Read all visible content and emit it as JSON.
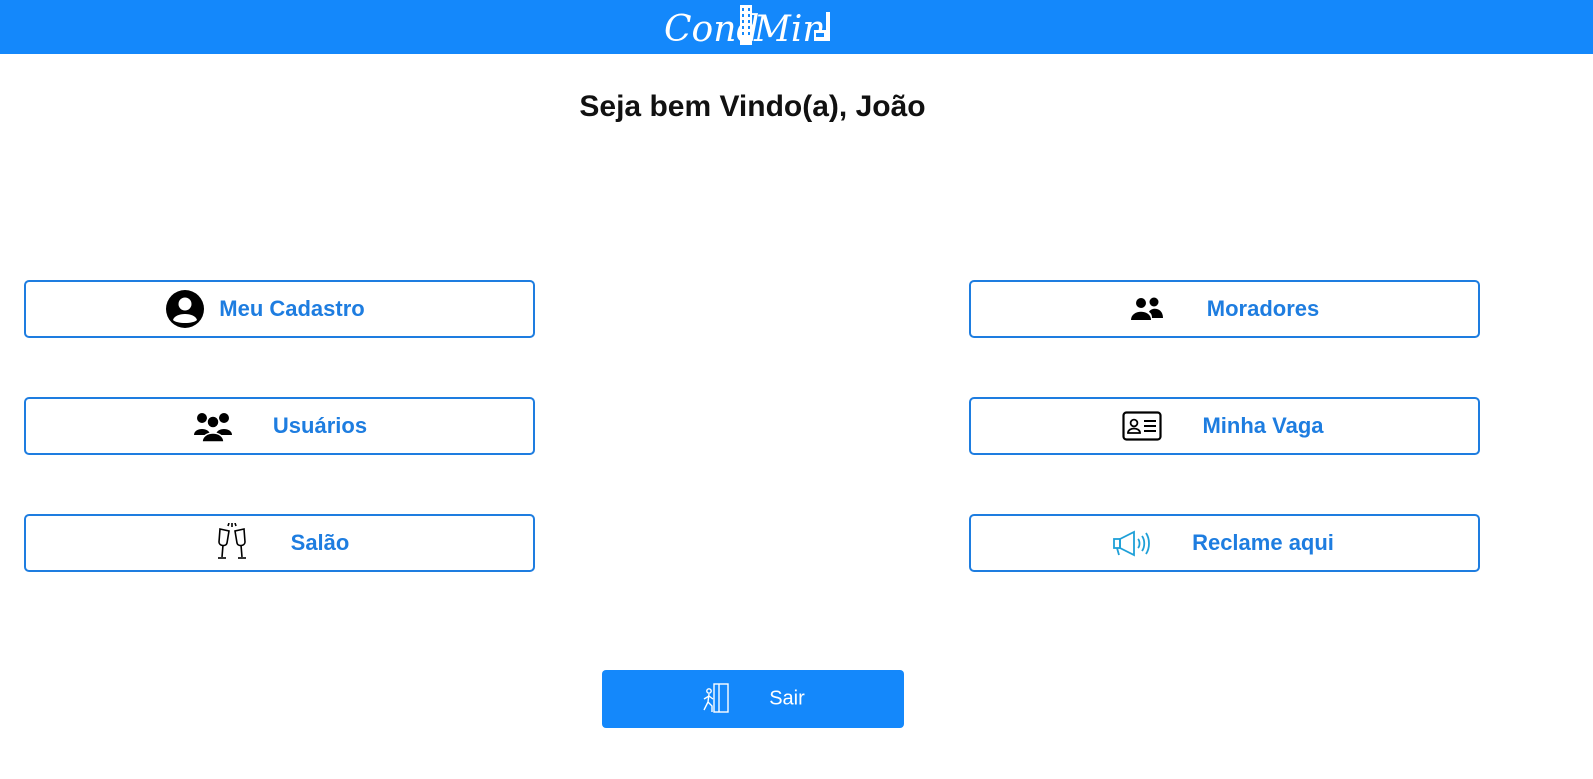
{
  "header": {
    "logo_text_left": "Cond",
    "logo_text_right": "Min",
    "brand_color": "#1488fb"
  },
  "welcome": {
    "text": "Seja bem Vindo(a), João"
  },
  "menu": {
    "meu_cadastro": {
      "label": "Meu Cadastro",
      "icon": "user-circle-icon"
    },
    "usuarios": {
      "label": "Usuários",
      "icon": "users-group-icon"
    },
    "salao": {
      "label": "Salão",
      "icon": "champagne-glasses-icon"
    },
    "moradores": {
      "label": "Moradores",
      "icon": "people-icon"
    },
    "minha_vaga": {
      "label": "Minha Vaga",
      "icon": "id-card-icon"
    },
    "reclame_aqui": {
      "label": "Reclame aqui",
      "icon": "megaphone-icon"
    }
  },
  "logout": {
    "label": "Sair",
    "icon": "exit-door-icon"
  },
  "colors": {
    "accent": "#1e7de0",
    "button_bg": "#1488fb",
    "text_dark": "#111111"
  }
}
